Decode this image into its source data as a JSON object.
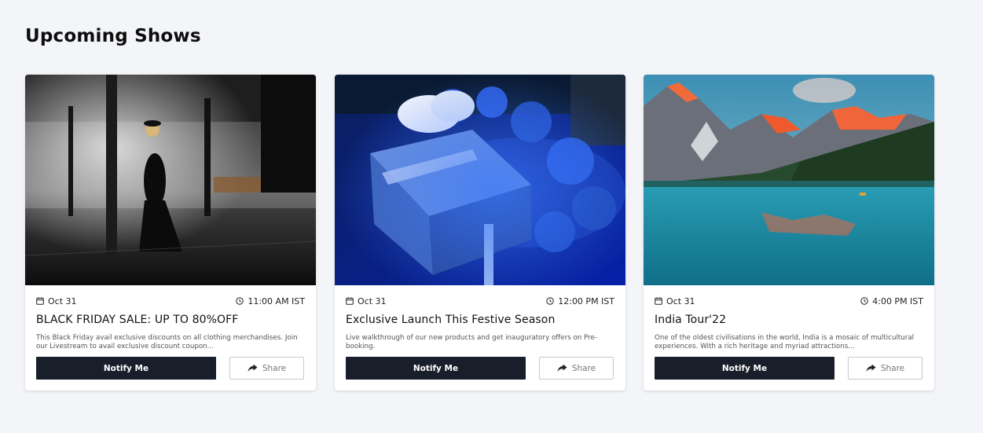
{
  "header": {
    "title": "Upcoming Shows"
  },
  "icons": {
    "date": "calendar-icon",
    "time": "clock-icon",
    "share": "share-arrow-icon"
  },
  "colors": {
    "notify_button_bg": "#181e2a",
    "page_bg": "#f4f5f9"
  },
  "cards": [
    {
      "image": "fashion-runway-photo",
      "date": "Oct 31",
      "time": "11:00 AM IST",
      "title": "BLACK FRIDAY SALE: UP TO 80%OFF",
      "description": "This Black Friday avail exclusive discounts on all clothing merchandises. Join our Livestream to avail exclusive discount coupon...",
      "notify_label": "Notify Me",
      "share_label": "Share"
    },
    {
      "image": "gift-box-photo",
      "date": "Oct 31",
      "time": "12:00 PM IST",
      "title": "Exclusive Launch This Festive Season",
      "description": "Live walkthrough of our new products and get inauguratory offers on Pre-booking.",
      "notify_label": "Notify Me",
      "share_label": "Share"
    },
    {
      "image": "mountain-lake-photo",
      "date": "Oct 31",
      "time": "4:00 PM IST",
      "title": "India Tour'22",
      "description": "One of the oldest civilisations in the world, India is a mosaic of multicultural experiences. With a rich heritage and myriad attractions...",
      "notify_label": "Notify Me",
      "share_label": "Share"
    }
  ]
}
